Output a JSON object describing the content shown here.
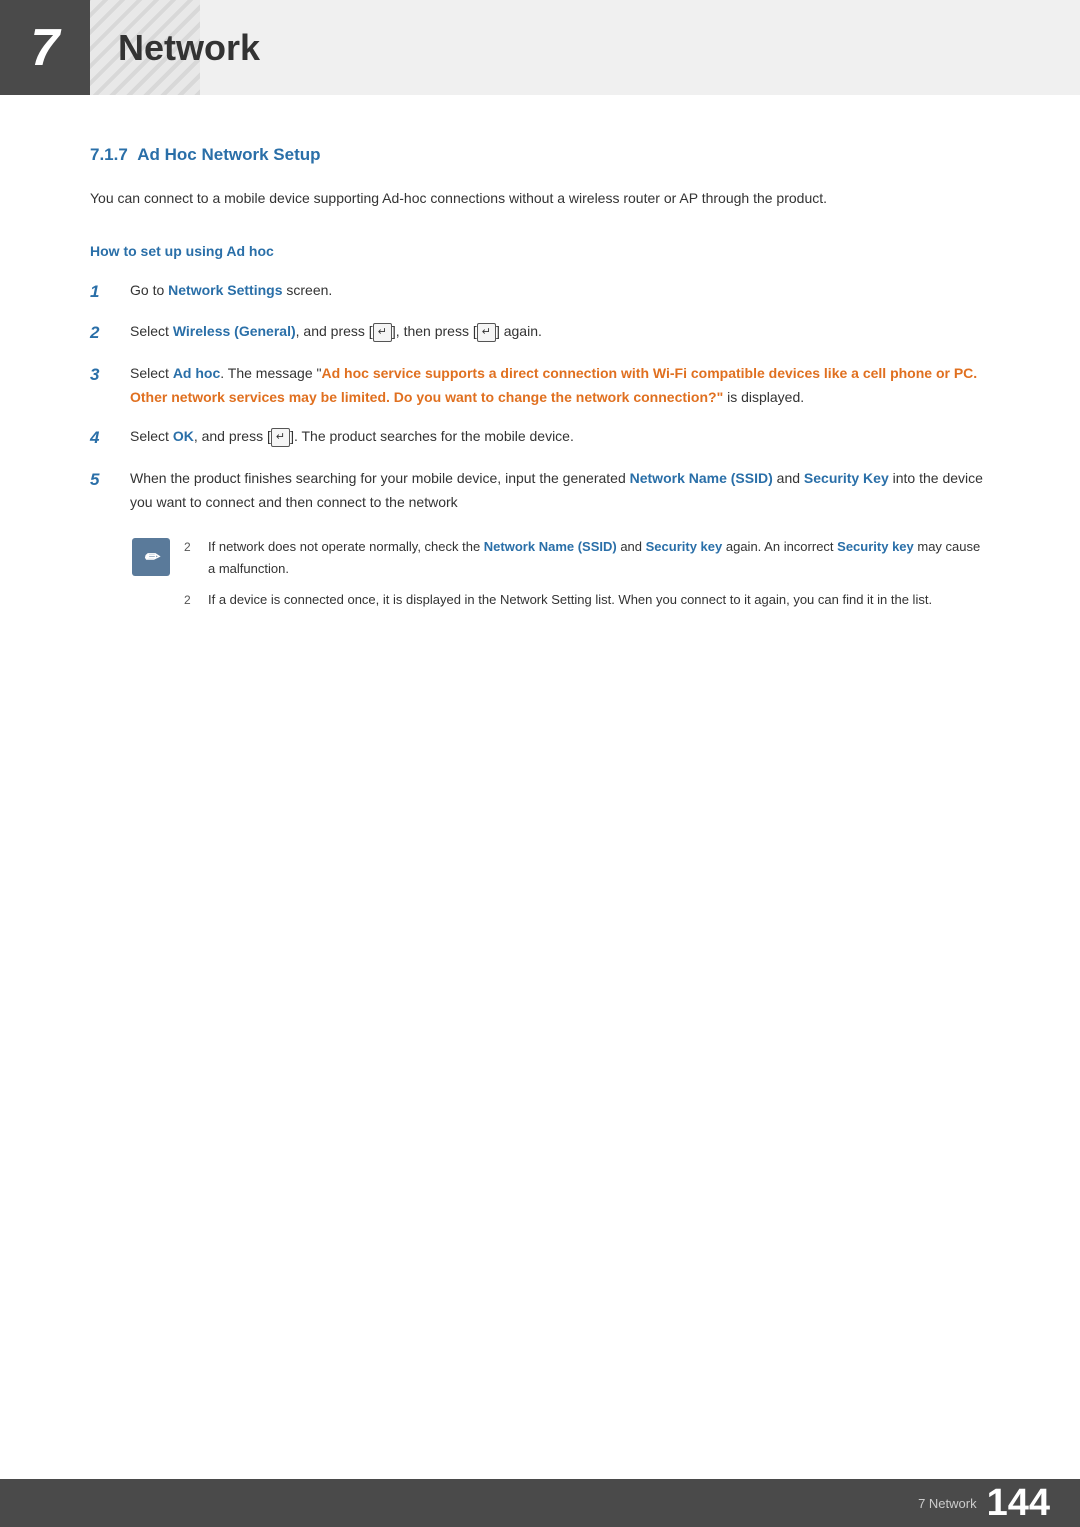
{
  "header": {
    "chapter_number": "7",
    "chapter_title": "Network",
    "stripe_color": "#d8d8d8"
  },
  "section": {
    "number": "7.1.7",
    "title": "Ad Hoc Network Setup",
    "description": "You can connect to a mobile device supporting Ad-hoc connections without a wireless router or AP through the product.",
    "subsection_title": "How to set up using Ad hoc"
  },
  "steps": [
    {
      "number": "1",
      "text_parts": [
        {
          "text": "Go to ",
          "bold": false,
          "blue": false
        },
        {
          "text": "Network Settings",
          "bold": true,
          "blue": true
        },
        {
          "text": " screen.",
          "bold": false,
          "blue": false
        }
      ]
    },
    {
      "number": "2",
      "text_parts": [
        {
          "text": "Select ",
          "bold": false,
          "blue": false
        },
        {
          "text": "Wireless (General)",
          "bold": true,
          "blue": true
        },
        {
          "text": ", and press [",
          "bold": false,
          "blue": false
        },
        {
          "text": "⏎",
          "bold": false,
          "blue": false,
          "key": true
        },
        {
          "text": "], then press [",
          "bold": false,
          "blue": false
        },
        {
          "text": "⏎",
          "bold": false,
          "blue": false,
          "key": true
        },
        {
          "text": "] again.",
          "bold": false,
          "blue": false
        }
      ]
    },
    {
      "number": "3",
      "text_parts": [
        {
          "text": "Select ",
          "bold": false,
          "blue": false
        },
        {
          "text": "Ad hoc",
          "bold": true,
          "blue": true
        },
        {
          "text": ". The message \"",
          "bold": false,
          "blue": false
        },
        {
          "text": "Ad hoc service supports a direct connection with Wi-Fi compatible devices like a cell phone or PC. Other network services may be limited. Do you want to change the network connection?\"",
          "bold": true,
          "blue": false,
          "orange": true
        },
        {
          "text": " ",
          "bold": false,
          "blue": false
        },
        {
          "text": "is displayed.",
          "bold": false,
          "blue": false
        }
      ]
    },
    {
      "number": "4",
      "text_parts": [
        {
          "text": "Select ",
          "bold": false,
          "blue": false
        },
        {
          "text": "OK",
          "bold": true,
          "blue": true
        },
        {
          "text": ", and press [",
          "bold": false,
          "blue": false
        },
        {
          "text": "⏎",
          "bold": false,
          "blue": false,
          "key": true
        },
        {
          "text": "]. The product searches for the mobile device.",
          "bold": false,
          "blue": false
        }
      ]
    },
    {
      "number": "5",
      "text_parts": [
        {
          "text": "When the product finishes searching for your mobile device, input the generated ",
          "bold": false,
          "blue": false
        },
        {
          "text": "Network Name (SSID)",
          "bold": true,
          "blue": true
        },
        {
          "text": " and ",
          "bold": false,
          "blue": false
        },
        {
          "text": "Security Key",
          "bold": true,
          "blue": true
        },
        {
          "text": " into the device you want to connect and then connect to the network",
          "bold": false,
          "blue": false
        }
      ]
    }
  ],
  "notes": [
    {
      "bullet": "2",
      "text_parts": [
        {
          "text": "If network does not operate normally, check the ",
          "bold": false,
          "blue": false
        },
        {
          "text": "Network Name (SSID)",
          "bold": true,
          "blue": true
        },
        {
          "text": " and ",
          "bold": false,
          "blue": false
        },
        {
          "text": "Security key",
          "bold": true,
          "blue": true
        },
        {
          "text": " again. An incorrect ",
          "bold": false,
          "blue": false
        },
        {
          "text": "Security key",
          "bold": true,
          "blue": true
        },
        {
          "text": " may cause a malfunction.",
          "bold": false,
          "blue": false
        }
      ]
    },
    {
      "bullet": "2",
      "text_parts": [
        {
          "text": "If a device is connected once, it is displayed in the Network Setting list. When you connect to it again, you can find it in the list.",
          "bold": false,
          "blue": false
        }
      ]
    }
  ],
  "footer": {
    "label": "7 Network",
    "page": "144"
  },
  "colors": {
    "blue": "#2a6fa8",
    "orange": "#e07020",
    "dark_bg": "#4a4a4a",
    "note_bg": "#5a7a9a"
  }
}
